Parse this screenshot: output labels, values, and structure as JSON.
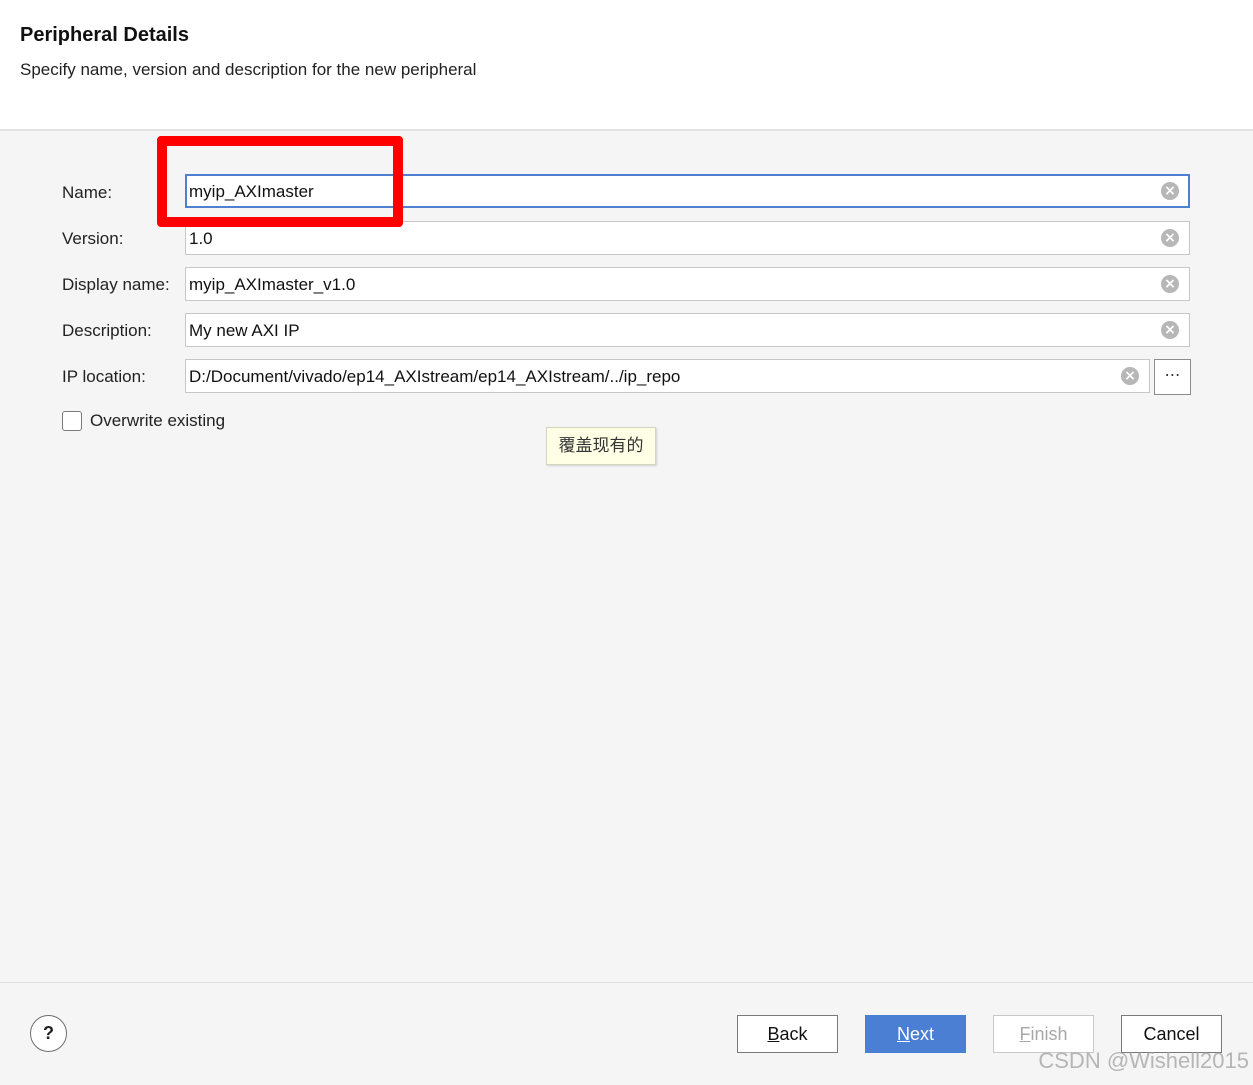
{
  "header": {
    "title": "Peripheral Details",
    "subtitle": "Specify name, version and description for the new peripheral"
  },
  "form": {
    "name": {
      "label": "Name:",
      "value": "myip_AXImaster"
    },
    "version": {
      "label": "Version:",
      "value": "1.0"
    },
    "display_name": {
      "label": "Display name:",
      "value": "myip_AXImaster_v1.0"
    },
    "description": {
      "label": "Description:",
      "value": "My new AXI IP"
    },
    "ip_location": {
      "label": "IP location:",
      "value": "D:/Document/vivado/ep14_AXIstream/ep14_AXIstream/../ip_repo",
      "browse_label": "⋯"
    },
    "overwrite": {
      "label": "Overwrite existing",
      "checked": false
    }
  },
  "tooltip": {
    "text": "覆盖现有的"
  },
  "footer": {
    "help_label": "?",
    "back": {
      "mnemonic": "B",
      "rest": "ack"
    },
    "next": {
      "mnemonic": "N",
      "rest": "ext"
    },
    "finish": {
      "mnemonic": "F",
      "rest": "inish",
      "enabled": false
    },
    "cancel": {
      "label": "Cancel"
    }
  },
  "icons": {
    "clear": "clear-circle-x-icon",
    "help": "help-question-icon",
    "browse": "ellipsis-icon"
  },
  "colors": {
    "primary_button": "#4a7fd4",
    "focus_border": "#4f7fd0",
    "annotation_highlight": "#ff0000",
    "tooltip_bg": "#ffffe6"
  },
  "watermark": "CSDN @Wishell2015"
}
